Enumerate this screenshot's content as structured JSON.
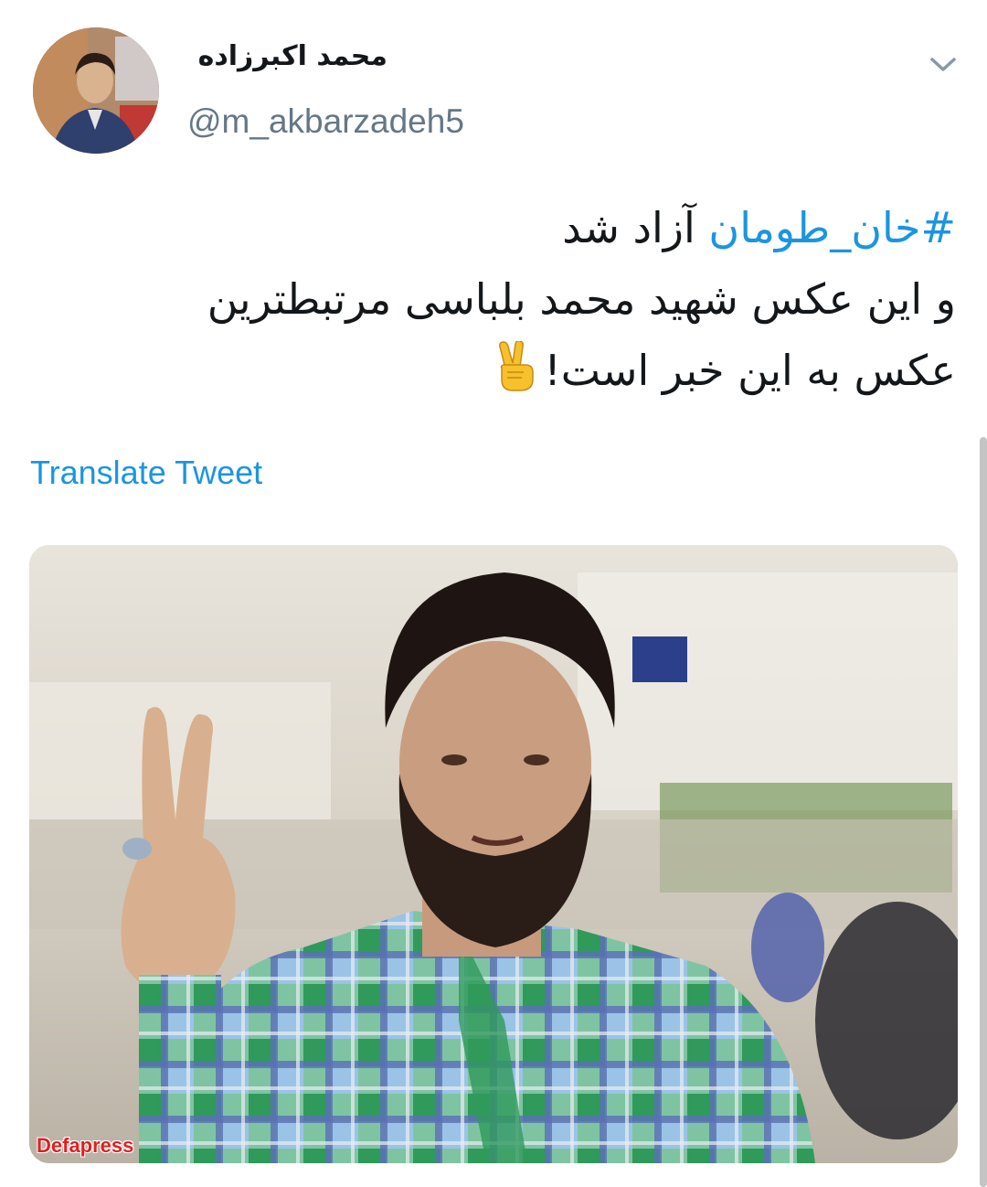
{
  "tweet": {
    "author": {
      "display_name": "محمد اکبرزاده",
      "handle": "@m_akbarzadeh5",
      "avatar_icon": "profile-photo"
    },
    "menu_icon": "chevron-down-icon",
    "text": {
      "hashtag": "#خان_طومان",
      "line1_rest": " آزاد شد",
      "line2": "و این عکس شهید محمد بلباسی مرتبطترین",
      "line3": "عکس به این خبر است!",
      "emoji": "victory-hand-emoji"
    },
    "translate_label": "Translate Tweet",
    "media": {
      "watermark": "Defapress"
    }
  },
  "colors": {
    "link": "#1b95e0",
    "secondary_text": "#657786",
    "primary_text": "#14171a"
  }
}
